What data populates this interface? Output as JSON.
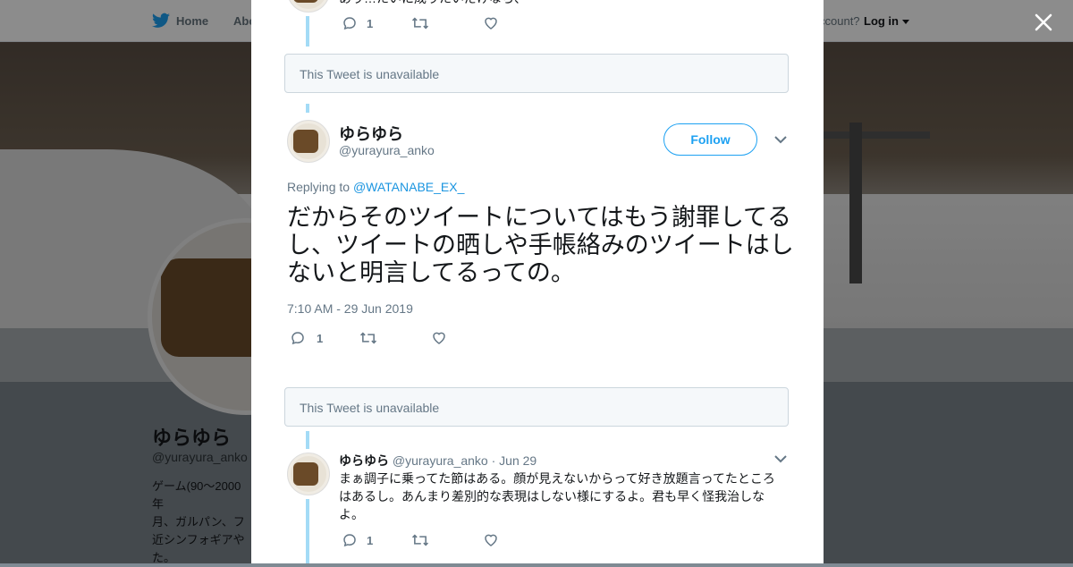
{
  "nav": {
    "home": "Home",
    "about": "Abo",
    "account": "ccount?",
    "login": "Log in"
  },
  "profile": {
    "name": "ゆらゆら",
    "handle": "@yurayura_anko",
    "bio_lines": [
      "ゲーム(90～2000年",
      "月、ガルパン、フ",
      "近シンフォギアや",
      "た。"
    ]
  },
  "thread": {
    "top_tweet": {
      "text_fragment": "あり…たいに成りたいだけなら、",
      "reply_count": "1"
    },
    "unavailable_1": "This Tweet is unavailable",
    "main": {
      "name": "ゆらゆら",
      "handle": "@yurayura_anko",
      "follow_label": "Follow",
      "replying_prefix": "Replying to",
      "replying_to": "@WATANABE_EX_",
      "text": "だからそのツイートについてはもう謝罪してるし、ツイートの晒しや手帳絡みのツイートはしないと明言してるっての。",
      "timestamp": "7:10 AM - 29 Jun 2019",
      "reply_count": "1"
    },
    "unavailable_2": "This Tweet is unavailable",
    "reply": {
      "name": "ゆらゆら",
      "handle": "@yurayura_anko",
      "date": "· Jun 29",
      "text": "まぁ調子に乗ってた節はある。顔が見えないからって好き放題言ってたところはあるし。あんまり差別的な表現はしない様にするよ。君も早く怪我治しなよ。",
      "reply_count": "1"
    }
  },
  "colors": {
    "accent": "#1da1f2",
    "thread_line": "#a3dbf6",
    "muted": "#657786"
  }
}
